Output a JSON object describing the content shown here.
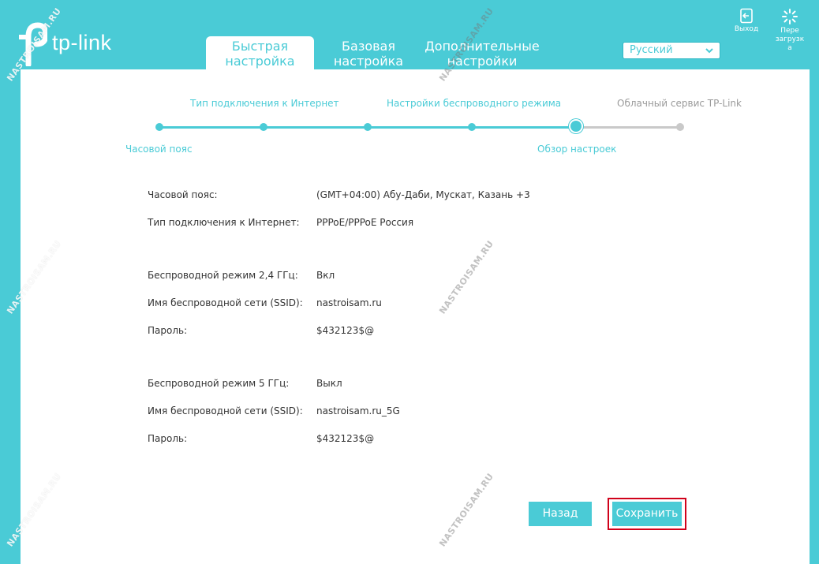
{
  "header": {
    "logo_text": "tp-link",
    "tabs": [
      {
        "line1": "Быстрая",
        "line2": "настройка"
      },
      {
        "line1": "Базовая",
        "line2": "настройка"
      },
      {
        "line1": "Дополнительные",
        "line2": "настройки"
      }
    ],
    "language": "Русский",
    "logout_label": "Выход",
    "reboot_label_1": "Пере",
    "reboot_label_2": "загрузк",
    "reboot_label_3": "а"
  },
  "progress": {
    "steps": [
      "Часовой пояс",
      "Тип подключения к Интернет",
      "",
      "Настройки беспроводного режима",
      "Обзор настроек",
      "Облачный сервис TP-Link"
    ]
  },
  "summary": {
    "rows": [
      {
        "label": "Часовой пояс:",
        "value": "(GMT+04:00) Абу-Даби, Мускат, Казань +3"
      },
      {
        "label": "Тип подключения к Интернет:",
        "value": "PPPoE/PPPoE Россия"
      },
      {
        "label": "Беспроводной режим 2,4 ГГц:",
        "value": "Вкл"
      },
      {
        "label": "Имя беспроводной сети (SSID):",
        "value": "nastroisam.ru"
      },
      {
        "label": "Пароль:",
        "value": "$432123$@"
      },
      {
        "label": "Беспроводной режим 5 ГГц:",
        "value": "Выкл"
      },
      {
        "label": "Имя беспроводной сети (SSID):",
        "value": "nastroisam.ru_5G"
      },
      {
        "label": "Пароль:",
        "value": "$432123$@"
      }
    ]
  },
  "buttons": {
    "back": "Назад",
    "save": "Сохранить"
  },
  "watermark": "NASTROISAM.RU",
  "colors": {
    "accent": "#4acbd6",
    "highlight": "#d0021b"
  }
}
